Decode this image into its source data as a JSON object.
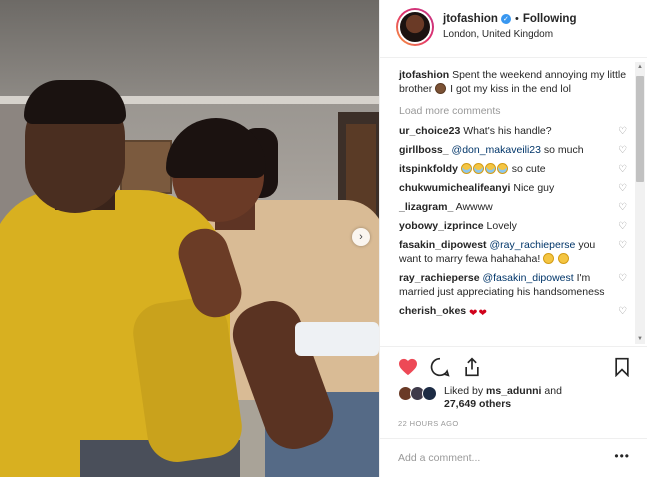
{
  "post": {
    "photo_alt": "Photo",
    "carousel_next_icon": "chevron-right-icon"
  },
  "header": {
    "username": "jtofashion",
    "verified_icon": "verified-badge-icon",
    "separator": "•",
    "follow_status": "Following",
    "location": "London, United Kingdom"
  },
  "caption": {
    "username": "jtofashion",
    "text_1": "Spent the weekend annoying my little brother",
    "emoji": "monkey",
    "text_2": "I got my kiss in the end lol"
  },
  "load_more": "Load more comments",
  "comments": [
    {
      "user": "ur_choice23",
      "text": "What's his handle?"
    },
    {
      "user": "girllboss_",
      "mention": "@don_makaveili23",
      "text": "so much"
    },
    {
      "user": "itspinkfoldy",
      "text": "so cute"
    },
    {
      "user": "chukwumichealifeanyi",
      "text": "Nice guy"
    },
    {
      "user": "_lizagram_",
      "text": "Awwww"
    },
    {
      "user": "yobowy_izprince",
      "text": "Lovely"
    },
    {
      "user": "fasakin_dipowest",
      "mention": "@ray_rachieperse",
      "text": "you want to marry fewa hahahaha!"
    },
    {
      "user": "ray_rachieperse",
      "mention": "@fasakin_dipowest",
      "text": "I'm married just appreciating his handsomeness"
    },
    {
      "user": "cherish_okes",
      "text": ""
    }
  ],
  "actions": {
    "like_icon": "heart-filled-icon",
    "comment_icon": "comment-bubble-icon",
    "share_icon": "share-icon",
    "save_icon": "bookmark-icon",
    "like_color": "#ed4956"
  },
  "likes": {
    "prefix": "Liked by",
    "user": "ms_adunni",
    "middle": "and",
    "count": "27,649 others"
  },
  "timestamp": "22 HOURS AGO",
  "add_comment": {
    "placeholder": "Add a comment...",
    "more_label": "•••"
  }
}
